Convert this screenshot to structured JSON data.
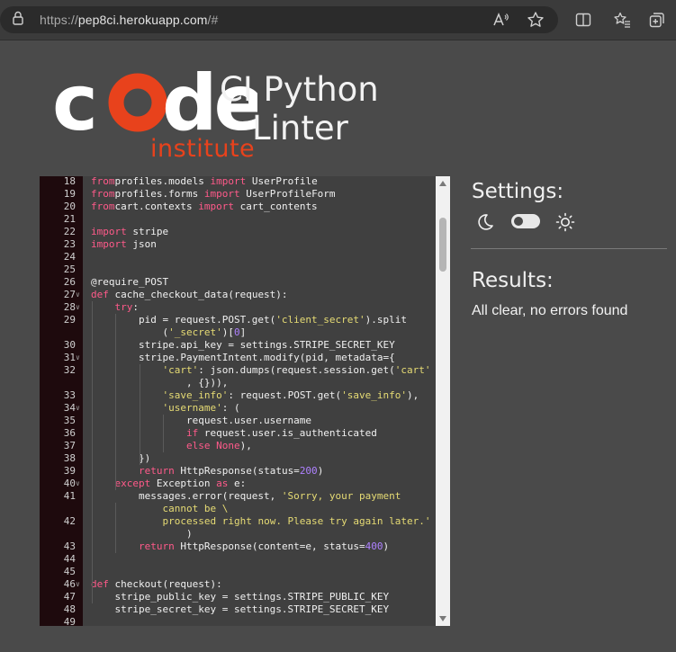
{
  "browser": {
    "url_scheme": "https://",
    "url_host": "pep8ci.herokuapp.com",
    "url_path": "/#"
  },
  "logo": {
    "word": "code",
    "sub": "institute"
  },
  "app_title_line1": "CI Python",
  "app_title_line2": "Linter",
  "settings_heading": "Settings:",
  "results_heading": "Results:",
  "results_text": "All clear, no errors found",
  "toggle_state": "off",
  "colors": {
    "accent": "#e8421c",
    "background": "#4a4a4a",
    "gutter": "#1e0a0d"
  },
  "code": [
    {
      "n": "18",
      "t": [
        [
          "kw",
          "from"
        ],
        [
          "",
          "profiles.models "
        ],
        [
          "kw",
          "import"
        ],
        [
          "",
          " UserProfile"
        ]
      ]
    },
    {
      "n": "19",
      "t": [
        [
          "kw",
          "from"
        ],
        [
          "",
          "profiles.forms "
        ],
        [
          "kw",
          "import"
        ],
        [
          "",
          " UserProfileForm"
        ]
      ]
    },
    {
      "n": "20",
      "t": [
        [
          "kw",
          "from"
        ],
        [
          "",
          "cart.contexts "
        ],
        [
          "kw",
          "import"
        ],
        [
          "",
          " cart_contents"
        ]
      ]
    },
    {
      "n": "21",
      "t": []
    },
    {
      "n": "22",
      "t": [
        [
          "kw",
          "import"
        ],
        [
          "",
          " stripe"
        ]
      ]
    },
    {
      "n": "23",
      "t": [
        [
          "kw",
          "import"
        ],
        [
          "",
          " json"
        ]
      ]
    },
    {
      "n": "24",
      "t": []
    },
    {
      "n": "25",
      "t": []
    },
    {
      "n": "26",
      "t": [
        [
          "",
          "@require_POST"
        ]
      ]
    },
    {
      "n": "27",
      "f": true,
      "t": [
        [
          "kw",
          "def"
        ],
        [
          "",
          " cache_checkout_data(request):"
        ]
      ]
    },
    {
      "n": "28",
      "f": true,
      "t": [
        [
          "",
          "    "
        ],
        [
          "kw",
          "try"
        ],
        [
          "",
          ":"
        ]
      ]
    },
    {
      "n": "29",
      "t": [
        [
          "",
          "        pid = request.POST.get("
        ],
        [
          "str",
          "'client_secret'"
        ],
        [
          "",
          ").split"
        ]
      ]
    },
    {
      "n": "",
      "t": [
        [
          "",
          "            ("
        ],
        [
          "str",
          "'_secret'"
        ],
        [
          "",
          ")["
        ],
        [
          "num",
          "0"
        ],
        [
          "",
          "]"
        ]
      ]
    },
    {
      "n": "30",
      "t": [
        [
          "",
          "        stripe.api_key = settings.STRIPE_SECRET_KEY"
        ]
      ]
    },
    {
      "n": "31",
      "f": true,
      "t": [
        [
          "",
          "        stripe.PaymentIntent.modify(pid, metadata={"
        ]
      ]
    },
    {
      "n": "32",
      "t": [
        [
          "",
          "            "
        ],
        [
          "str",
          "'cart'"
        ],
        [
          "",
          ": json.dumps(request.session.get("
        ],
        [
          "str",
          "'cart'"
        ]
      ]
    },
    {
      "n": "",
      "t": [
        [
          "",
          "                , {})),"
        ]
      ]
    },
    {
      "n": "33",
      "t": [
        [
          "",
          "            "
        ],
        [
          "str",
          "'save_info'"
        ],
        [
          "",
          ": request.POST.get("
        ],
        [
          "str",
          "'save_info'"
        ],
        [
          "",
          "),"
        ]
      ]
    },
    {
      "n": "34",
      "f": true,
      "t": [
        [
          "",
          "            "
        ],
        [
          "str",
          "'username'"
        ],
        [
          "",
          ": ("
        ]
      ]
    },
    {
      "n": "35",
      "t": [
        [
          "",
          "                request.user.username"
        ]
      ]
    },
    {
      "n": "36",
      "t": [
        [
          "",
          "                "
        ],
        [
          "kw",
          "if"
        ],
        [
          "",
          " request.user.is_authenticated"
        ]
      ]
    },
    {
      "n": "37",
      "t": [
        [
          "",
          "                "
        ],
        [
          "kw",
          "else"
        ],
        [
          "",
          " "
        ],
        [
          "kw",
          "None"
        ],
        [
          "",
          "),"
        ]
      ]
    },
    {
      "n": "38",
      "t": [
        [
          "",
          "        })"
        ]
      ]
    },
    {
      "n": "39",
      "t": [
        [
          "",
          "        "
        ],
        [
          "kw",
          "return"
        ],
        [
          "",
          " HttpResponse(status="
        ],
        [
          "num",
          "200"
        ],
        [
          "",
          ")"
        ]
      ]
    },
    {
      "n": "40",
      "f": true,
      "t": [
        [
          "",
          "    "
        ],
        [
          "kw",
          "except"
        ],
        [
          "",
          " Exception "
        ],
        [
          "kw",
          "as"
        ],
        [
          "",
          " e:"
        ]
      ]
    },
    {
      "n": "41",
      "t": [
        [
          "",
          "        messages.error(request, "
        ],
        [
          "str",
          "'Sorry, your payment"
        ]
      ]
    },
    {
      "n": "",
      "t": [
        [
          "",
          "            "
        ],
        [
          "str",
          "cannot be \\"
        ]
      ]
    },
    {
      "n": "42",
      "t": [
        [
          "",
          "            "
        ],
        [
          "str",
          "processed right now. Please try again later.'"
        ]
      ]
    },
    {
      "n": "",
      "t": [
        [
          "",
          "                )"
        ]
      ]
    },
    {
      "n": "43",
      "t": [
        [
          "",
          "        "
        ],
        [
          "kw",
          "return"
        ],
        [
          "",
          " HttpResponse(content=e, status="
        ],
        [
          "num",
          "400"
        ],
        [
          "",
          ")"
        ]
      ]
    },
    {
      "n": "44",
      "t": []
    },
    {
      "n": "45",
      "t": []
    },
    {
      "n": "46",
      "f": true,
      "t": [
        [
          "kw",
          "def"
        ],
        [
          "",
          " checkout(request):"
        ]
      ]
    },
    {
      "n": "47",
      "t": [
        [
          "",
          "    stripe_public_key = settings.STRIPE_PUBLIC_KEY"
        ]
      ]
    },
    {
      "n": "48",
      "t": [
        [
          "",
          "    stripe_secret_key = settings.STRIPE_SECRET_KEY"
        ]
      ]
    },
    {
      "n": "49",
      "t": []
    }
  ]
}
